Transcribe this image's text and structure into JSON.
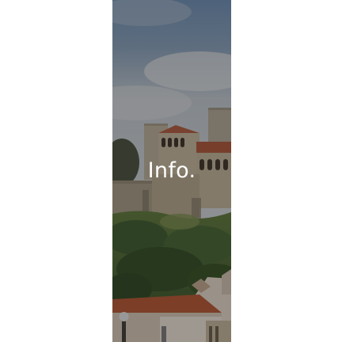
{
  "tile": {
    "label": "Info.",
    "overlay_color": "#191919",
    "text_color": "#ffffff"
  }
}
